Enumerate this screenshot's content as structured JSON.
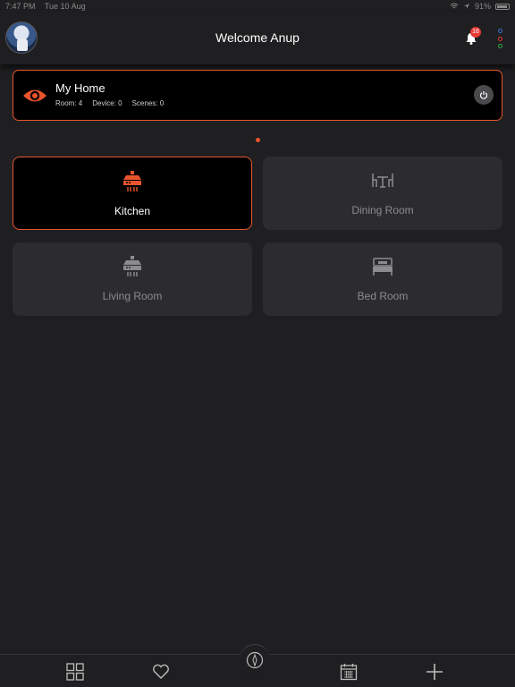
{
  "status_bar": {
    "time": "7:47 PM",
    "date": "Tue 10 Aug",
    "battery": "91%"
  },
  "header": {
    "title": "Welcome Anup",
    "notification_count": "16"
  },
  "home": {
    "name": "My Home",
    "room_label": "Room: 4",
    "device_label": "Device: 0",
    "scene_label": "Scenes: 0"
  },
  "rooms": [
    {
      "label": "Kitchen",
      "icon": "kitchen-hood-icon",
      "active": true
    },
    {
      "label": "Dining Room",
      "icon": "dining-table-icon",
      "active": false
    },
    {
      "label": "Living Room",
      "icon": "kitchen-hood-icon",
      "active": false
    },
    {
      "label": "Bed Room",
      "icon": "bed-icon",
      "active": false
    }
  ],
  "colors": {
    "accent": "#e8542c",
    "background": "#1f1f21",
    "card": "#2c2c2e",
    "badge": "#e53935"
  },
  "tabs": [
    "grid-icon",
    "heart-icon",
    "compass-icon",
    "calendar-icon",
    "plus-icon"
  ]
}
